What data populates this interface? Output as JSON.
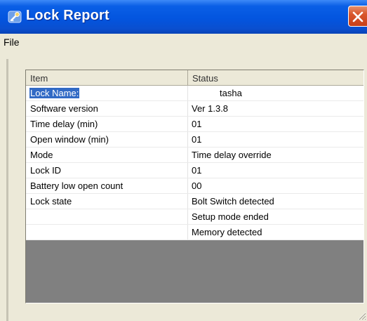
{
  "window": {
    "title": "Lock Report",
    "colors": {
      "titlebar": "#0355df",
      "close": "#d9562b",
      "selection": "#316ac5",
      "background": "#ece9d8"
    }
  },
  "menu": {
    "file_label": "File"
  },
  "table": {
    "headers": {
      "item": "Item",
      "status": "Status"
    },
    "rows": [
      {
        "item": "Lock Name:",
        "status": "tasha"
      },
      {
        "item": "Software version",
        "status": "Ver 1.3.8"
      },
      {
        "item": "Time delay (min)",
        "status": "01"
      },
      {
        "item": "Open window (min)",
        "status": "01"
      },
      {
        "item": "Mode",
        "status": "Time delay override"
      },
      {
        "item": "Lock ID",
        "status": "01"
      },
      {
        "item": "Battery low open count",
        "status": "00"
      },
      {
        "item": "Lock state",
        "status": "Bolt Switch detected"
      },
      {
        "item": "",
        "status": "Setup mode ended"
      },
      {
        "item": "",
        "status": "Memory detected"
      }
    ]
  },
  "icons": {
    "title": "key-lock-icon",
    "close": "close-icon",
    "grip": "resize-grip-icon"
  }
}
